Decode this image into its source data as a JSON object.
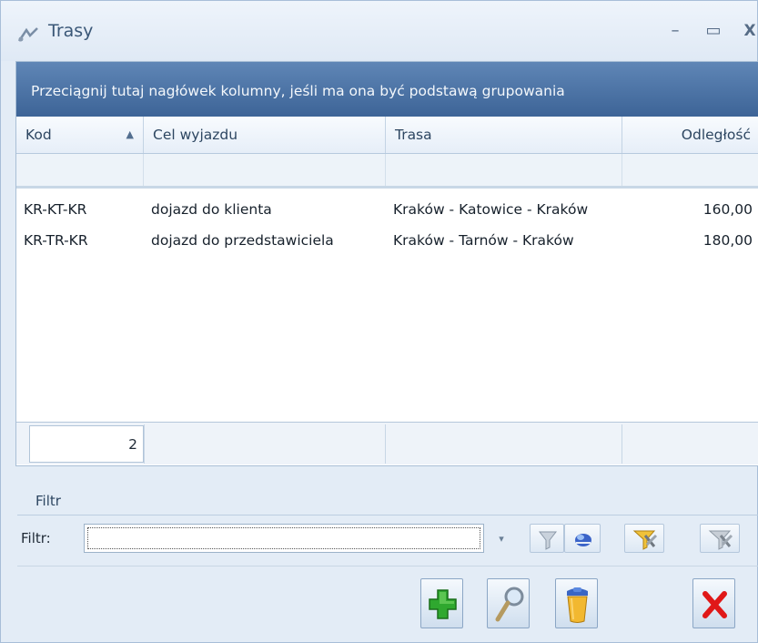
{
  "window": {
    "title": "Trasy",
    "minimize_label": "–",
    "maximize_label": "▭",
    "close_label": "X"
  },
  "grid": {
    "group_hint": "Przeciągnij tutaj nagłówek kolumny, jeśli ma ona być podstawą grupowania",
    "columns": [
      {
        "label": "Kod",
        "sorted": "ascending"
      },
      {
        "label": "Cel wyjazdu"
      },
      {
        "label": "Trasa"
      },
      {
        "label": "Odległość"
      }
    ],
    "sort_indicator": "▲",
    "rows": [
      {
        "kod": "KR-KT-KR",
        "cel": "dojazd do klienta",
        "trasa": "Kraków - Katowice - Kraków",
        "odleglosc": "160,00"
      },
      {
        "kod": "KR-TR-KR",
        "cel": "dojazd do przedstawiciela",
        "trasa": "Kraków - Tarnów - Kraków",
        "odleglosc": "180,00"
      }
    ],
    "row_count": "2"
  },
  "filter": {
    "section_caption": "Filtr",
    "label": "Filtr:",
    "value": "",
    "dropdown_arrow": "▾"
  },
  "toolbar_icons": [
    "filter-icon",
    "clear-filter-icon",
    "filter-edit-icon",
    "filter-remove-icon"
  ],
  "actions": [
    "add-icon",
    "view-icon",
    "delete-icon",
    "close-icon"
  ],
  "colors": {
    "group_panel": "#4a71a3",
    "accent_green": "#2fa82f",
    "accent_red": "#e01818"
  }
}
